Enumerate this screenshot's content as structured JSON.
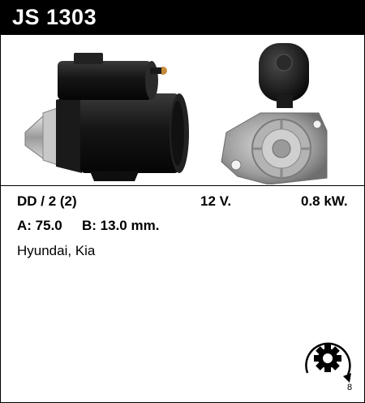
{
  "header": {
    "title": "JS 1303",
    "background": "#000000",
    "text_color": "#ffffff"
  },
  "photo": {
    "left_image": "starter-motor-side-view",
    "right_image": "starter-motor-front-view"
  },
  "specs": {
    "drive": "DD / 2 (2)",
    "voltage": "12 V.",
    "power": "0.8 kW.",
    "dim_a": "A: 75.0",
    "dim_b": "B: 13.0 mm."
  },
  "application": "Hyundai, Kia",
  "rotation": {
    "icon": "clockwise-rotation-gear-icon",
    "teeth": "8"
  }
}
